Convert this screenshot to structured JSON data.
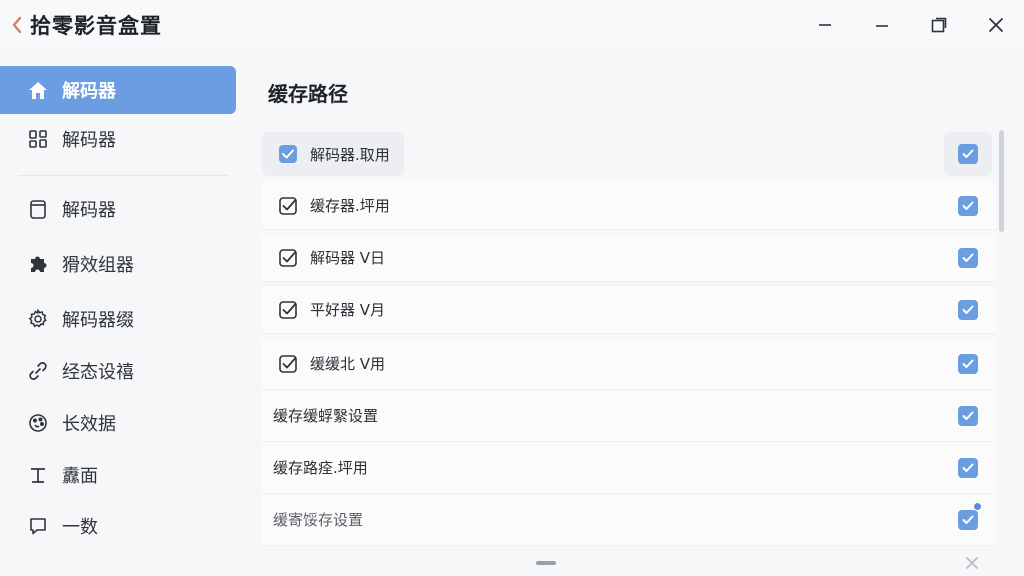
{
  "window": {
    "title": "拾零影音盒置",
    "controls": [
      "minimize-icon",
      "maximize-icon",
      "restore-icon",
      "close-icon"
    ]
  },
  "sidebar": {
    "items": [
      {
        "label": "解码器",
        "icon": "home-icon",
        "active": true
      },
      {
        "label": "解码器",
        "icon": "grid-icon",
        "active": false
      },
      {
        "label": "解码器",
        "icon": "document-icon",
        "active": false
      },
      {
        "label": "猾效组器",
        "icon": "puzzle-icon",
        "active": false
      },
      {
        "label": "解码器缀",
        "icon": "gear-icon",
        "active": false
      },
      {
        "label": "经态设禧",
        "icon": "link-icon",
        "active": false
      },
      {
        "label": "长效据",
        "icon": "palette-icon",
        "active": false
      },
      {
        "label": "纛面",
        "icon": "text-icon",
        "active": false
      },
      {
        "label": "一数",
        "icon": "chat-icon",
        "active": false
      }
    ]
  },
  "main": {
    "title": "缓存路径",
    "rows": [
      {
        "label": "解码器.取用",
        "lead": "filled-check",
        "checked": true
      },
      {
        "label": "缓存器.坪用",
        "lead": "outline-check",
        "checked": true
      },
      {
        "label": "解码器 V日",
        "lead": "outline-check",
        "checked": true
      },
      {
        "label": "平好器 V月",
        "lead": "outline-check",
        "checked": true
      },
      {
        "label": "缓缓北 V用",
        "lead": "outline-check",
        "checked": true
      },
      {
        "label": "缓存缓蜉繄设置",
        "lead": "none",
        "checked": true
      },
      {
        "label": "缓存路痊.坪用",
        "lead": "none",
        "checked": true
      },
      {
        "label": "缓寄馁存设置",
        "lead": "none",
        "checked": true
      }
    ]
  },
  "colors": {
    "accent": "#6b9de0",
    "checkbox": "#6a9ee0",
    "back_arrow": "#e0786a"
  }
}
